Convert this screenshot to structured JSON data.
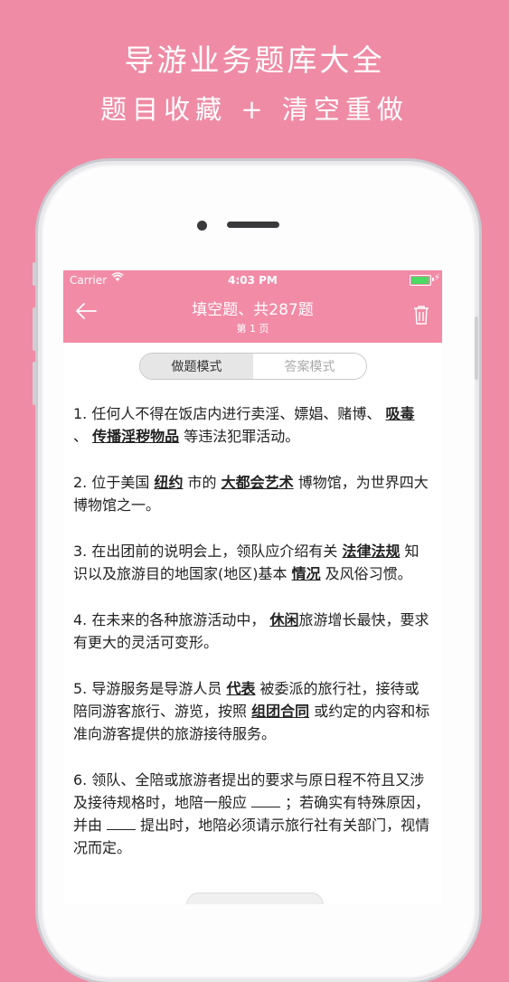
{
  "promo": {
    "title": "导游业务题库大全",
    "subtitle": "题目收藏 + 清空重做"
  },
  "status_bar": {
    "carrier": "Carrier",
    "time": "4:03 PM",
    "battery_level": 0.95
  },
  "navbar": {
    "title": "填空题、共287题",
    "page": "第 1 页",
    "back_icon": "arrow-left-icon",
    "delete_icon": "trash-icon"
  },
  "mode_switch": {
    "options": [
      "做题模式",
      "答案模式"
    ],
    "selected": "做题模式"
  },
  "questions": [
    {
      "parts": [
        {
          "t": "1. 任何人不得在饭店内进行卖淫、嫖娼、赌博、 "
        },
        {
          "t": "吸毒",
          "answer": true
        },
        {
          "t": " 、 "
        },
        {
          "t": "传播淫秽物品",
          "answer": true
        },
        {
          "t": " 等违法犯罪活动。"
        }
      ]
    },
    {
      "parts": [
        {
          "t": "2. 位于美国 "
        },
        {
          "t": "纽约",
          "answer": true
        },
        {
          "t": " 市的 "
        },
        {
          "t": "大都会艺术",
          "answer": true
        },
        {
          "t": " 博物馆，为世界四大博物馆之一。"
        }
      ]
    },
    {
      "parts": [
        {
          "t": "3. 在出团前的说明会上，领队应介绍有关 "
        },
        {
          "t": "法律法规",
          "answer": true
        },
        {
          "t": " 知识以及旅游目的地国家(地区)基本 "
        },
        {
          "t": "情况",
          "answer": true
        },
        {
          "t": " 及风俗习惯。"
        }
      ]
    },
    {
      "parts": [
        {
          "t": "4. 在未来的各种旅游活动中， "
        },
        {
          "t": "休闲",
          "answer": true
        },
        {
          "t": "旅游增长最快，要求有更大的灵活可变形。"
        }
      ]
    },
    {
      "parts": [
        {
          "t": "5. 导游服务是导游人员 "
        },
        {
          "t": "代表",
          "answer": true
        },
        {
          "t": " 被委派的旅行社，接待或陪同游客旅行、游览，按照 "
        },
        {
          "t": "组团合同",
          "answer": true
        },
        {
          "t": " 或约定的内容和标准向游客提供的旅游接待服务。"
        }
      ]
    },
    {
      "parts": [
        {
          "t": "6. 领队、全陪或旅游者提出的要求与原日程不符且又涉及接待规格时，地陪一般应 "
        },
        {
          "t": "",
          "blank": true
        },
        {
          "t": " ；若确实有特殊原因，并由 "
        },
        {
          "t": "",
          "blank": true
        },
        {
          "t": " 提出时，地陪必须请示旅行社有关部门，视情况而定。"
        }
      ]
    }
  ]
}
